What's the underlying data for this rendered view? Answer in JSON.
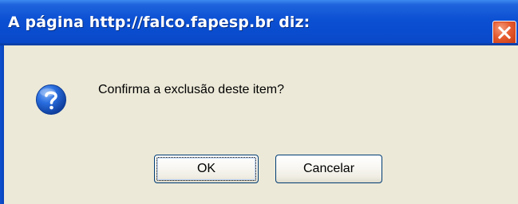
{
  "dialog": {
    "title": "A página http://falco.fapesp.br diz:",
    "message": "Confirma a exclusão deste item?",
    "icon": "question-icon",
    "buttons": {
      "ok_label": "OK",
      "cancel_label": "Cancelar"
    }
  },
  "colors": {
    "titlebar": "#0a4bcc",
    "close_button": "#e65a2f",
    "body_background": "#ece9d8",
    "question_icon": "#1f5fcf"
  }
}
